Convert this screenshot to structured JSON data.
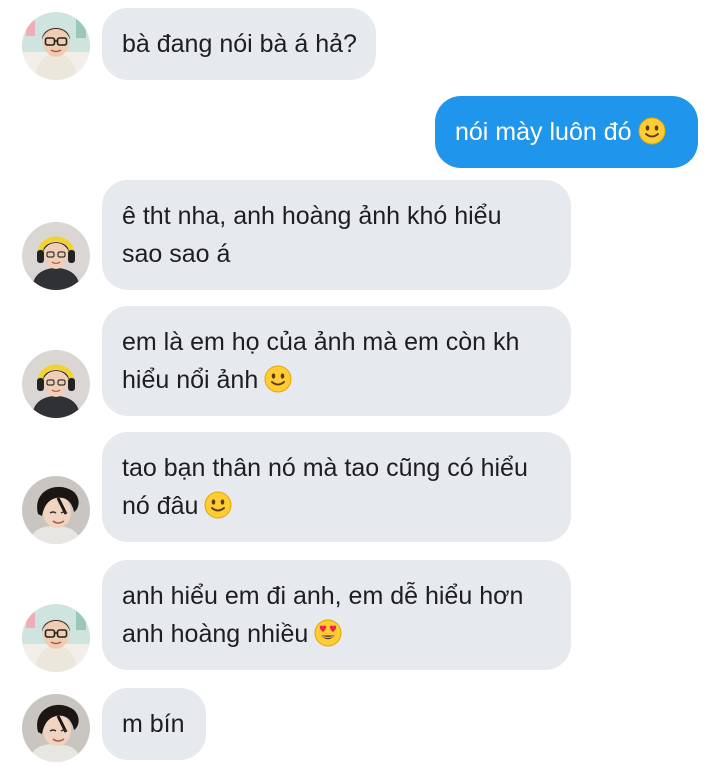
{
  "messages": [
    {
      "sender": "user-a",
      "direction": "in",
      "lines": [
        "bà đang nói bà á hả?"
      ]
    },
    {
      "sender": "me",
      "direction": "out",
      "text": "nói mày luôn đó",
      "emoji": "slightly-smiling-face"
    },
    {
      "sender": "user-b",
      "direction": "in",
      "lines": [
        "ê tht nha, anh hoàng ảnh khó hiểu",
        "sao sao á"
      ]
    },
    {
      "sender": "user-b",
      "direction": "in",
      "lines": [
        "em là em họ của ảnh mà em còn kh",
        "hiểu nổi ảnh"
      ],
      "emoji": "slightly-smiling-face"
    },
    {
      "sender": "user-c",
      "direction": "in",
      "lines": [
        "tao bạn thân nó mà tao cũng có hiểu",
        "nó đâu"
      ],
      "emoji": "slightly-smiling-face"
    },
    {
      "sender": "user-a",
      "direction": "in",
      "lines": [
        "anh hiểu em đi anh, em dễ hiểu hơn",
        "anh hoàng nhiều"
      ],
      "emoji": "heart-eyes-face"
    },
    {
      "sender": "user-c",
      "direction": "in",
      "lines": [
        "m bín"
      ]
    }
  ],
  "colors": {
    "incoming_bubble": "#e6e9ee",
    "outgoing_bubble": "#1f96eb",
    "incoming_text": "#1c1e21",
    "outgoing_text": "#ffffff"
  }
}
